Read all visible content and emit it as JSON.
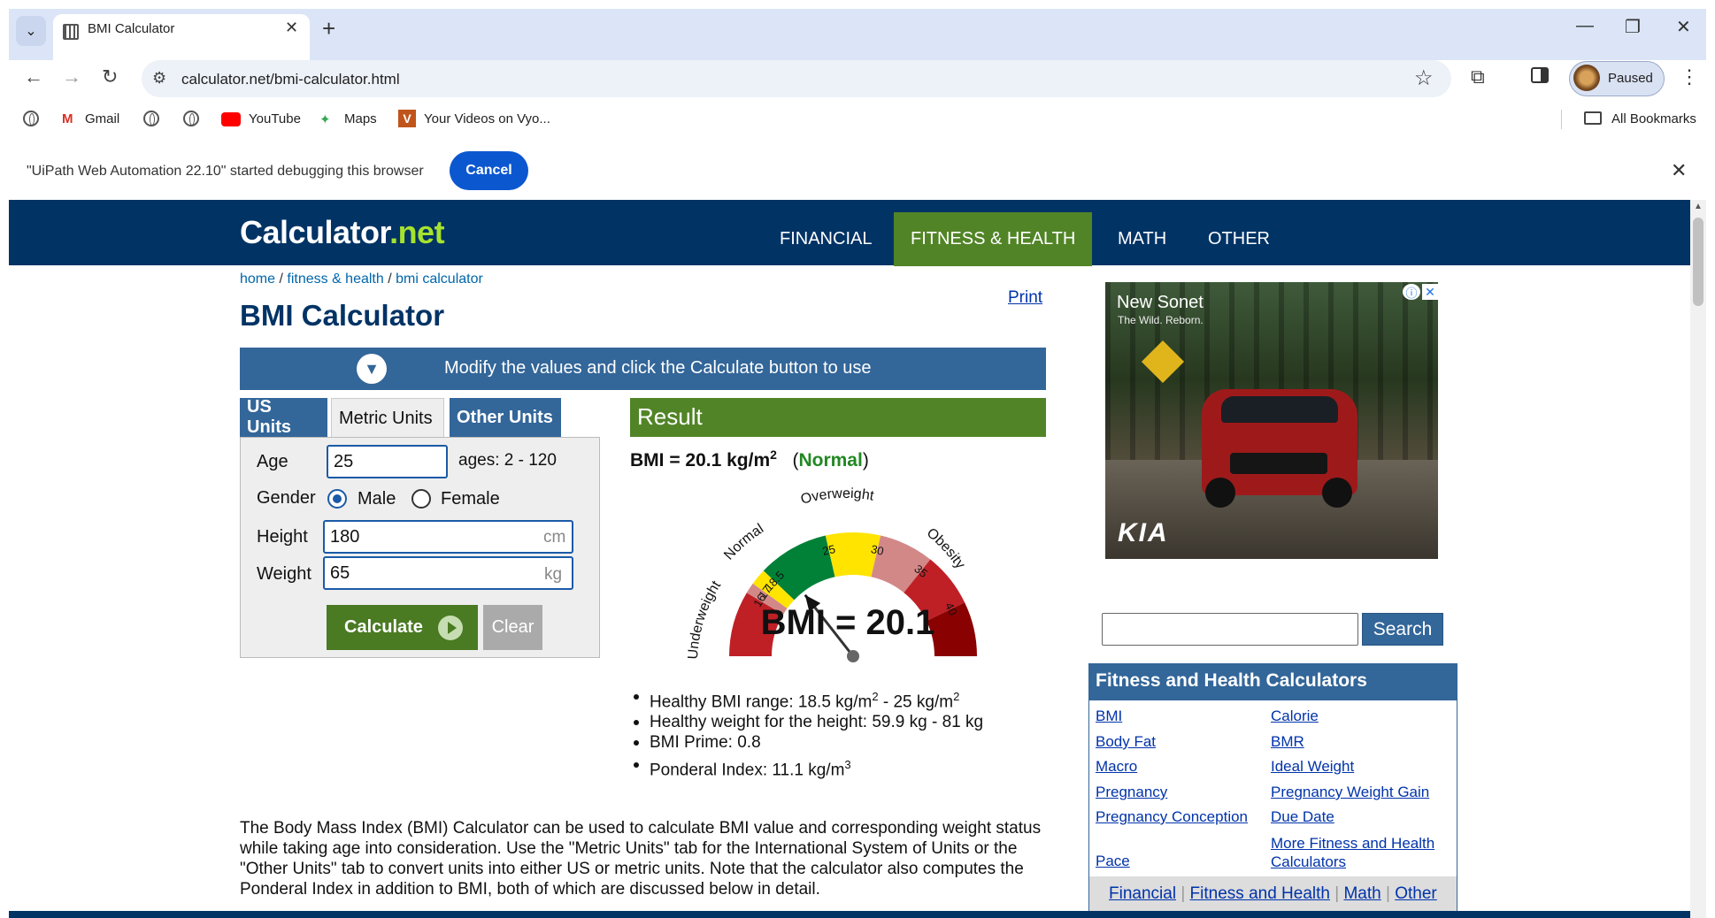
{
  "browser": {
    "tab_title": "BMI Calculator",
    "url": "calculator.net/bmi-calculator.html",
    "profile_label": "Paused",
    "bookmarks": [
      "Gmail",
      "YouTube",
      "Maps",
      "Your Videos on Vyo..."
    ],
    "all_bookmarks": "All Bookmarks",
    "infobar_text": "\"UiPath Web Automation 22.10\" started debugging this browser",
    "infobar_cancel": "Cancel"
  },
  "site": {
    "logo_main": "Calculator",
    "logo_net": ".net",
    "nav": [
      "FINANCIAL",
      "FITNESS & HEALTH",
      "MATH",
      "OTHER"
    ],
    "active_nav": "FITNESS & HEALTH",
    "breadcrumb": {
      "home": "home",
      "sep": " / ",
      "section": "fitness & health",
      "page": "bmi calculator"
    },
    "print": "Print",
    "title": "BMI Calculator",
    "banner": "Modify the values and click the Calculate button to use"
  },
  "form": {
    "tabs": [
      "US Units",
      "Metric Units",
      "Other Units"
    ],
    "active_tab": "Metric Units",
    "age_label": "Age",
    "age_value": "25",
    "age_hint": "ages: 2 - 120",
    "gender_label": "Gender",
    "gender_male": "Male",
    "gender_female": "Female",
    "gender_selected": "Male",
    "height_label": "Height",
    "height_value": "180",
    "height_unit": "cm",
    "weight_label": "Weight",
    "weight_value": "65",
    "weight_unit": "kg",
    "calculate": "Calculate",
    "clear": "Clear"
  },
  "result": {
    "header": "Result",
    "bmi_prefix": "BMI = 20.1 kg/m",
    "bmi_sup": "2",
    "classification": "Normal",
    "gauge_value": 20.1,
    "gauge_text": "BMI = 20.1",
    "gauge_labels": {
      "underweight": "Underweight",
      "normal": "Normal",
      "overweight": "Overweight",
      "obesity": "Obesity"
    },
    "gauge_ticks": [
      "16",
      "17",
      "18.5",
      "25",
      "30",
      "35",
      "40"
    ],
    "details": {
      "healthy_range_a": "Healthy BMI range: 18.5 kg/m",
      "healthy_range_b": " - 25 kg/m",
      "healthy_weight": "Healthy weight for the height: 59.9 kg - 81 kg",
      "bmi_prime": "BMI Prime: 0.8",
      "ponderal": "Ponderal Index: 11.1 kg/m",
      "sup2": "2",
      "sup3": "3"
    }
  },
  "description": "The Body Mass Index (BMI) Calculator can be used to calculate BMI value and corresponding weight status while taking age into consideration. Use the \"Metric Units\" tab for the International System of Units or the \"Other Units\" tab to convert units into either US or metric units. Note that the calculator also computes the Ponderal Index in addition to BMI, both of which are discussed below in detail.",
  "ad": {
    "headline": "New Sonet",
    "tagline": "The Wild. Reborn.",
    "brand": "KIA"
  },
  "sidebar": {
    "search_button": "Search",
    "fh_title": "Fitness and Health Calculators",
    "links_left": [
      "BMI",
      "Body Fat",
      "Macro",
      "Pregnancy",
      "Pregnancy Conception",
      "Pace"
    ],
    "links_right": [
      "Calorie",
      "BMR",
      "Ideal Weight",
      "Pregnancy Weight Gain",
      "Due Date",
      "More Fitness and Health Calculators"
    ],
    "footer_links": [
      "Financial",
      "Fitness and Health",
      "Math",
      "Other"
    ]
  }
}
